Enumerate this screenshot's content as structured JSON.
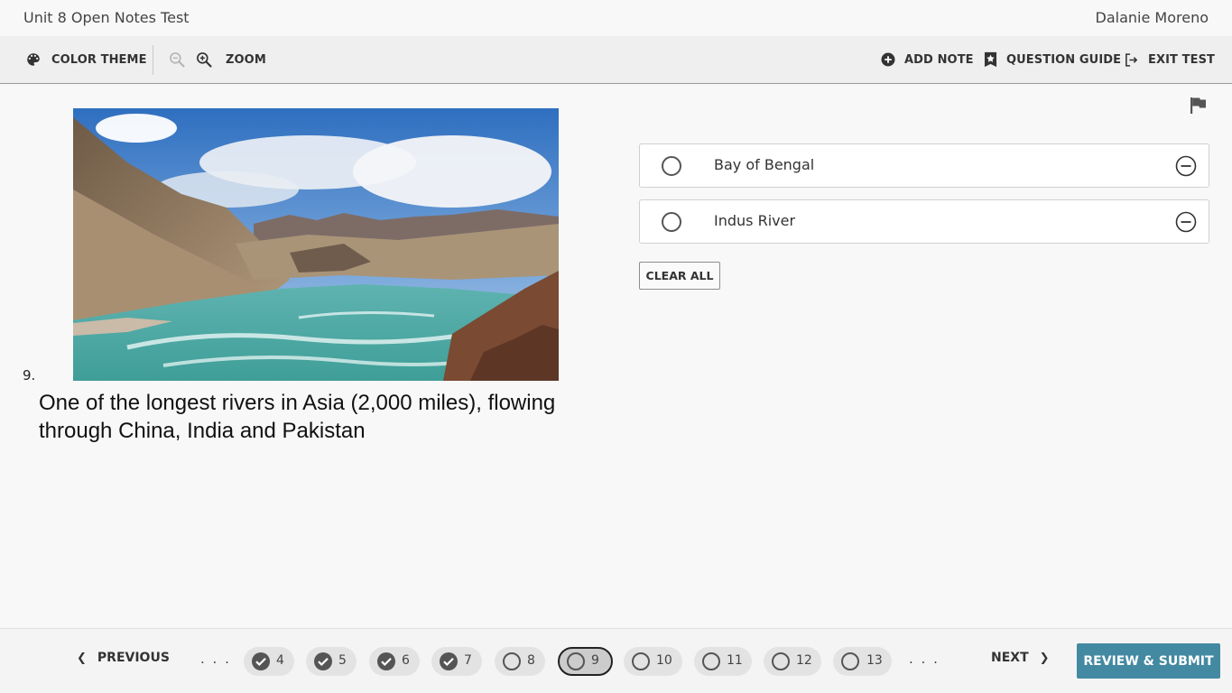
{
  "header": {
    "test_title": "Unit 8 Open Notes Test",
    "user_name": "Dalanie Moreno"
  },
  "toolbar": {
    "color_theme_label": "COLOR THEME",
    "zoom_label": "ZOOM",
    "add_note_label": "ADD NOTE",
    "question_guide_label": "QUESTION GUIDE",
    "exit_test_label": "EXIT TEST",
    "icons": [
      "palette-icon",
      "zoom-out-icon",
      "zoom-in-icon",
      "add-circle-icon",
      "bookmark-star-icon",
      "exit-icon"
    ]
  },
  "question": {
    "number": "9.",
    "text": "One of the longest rivers in Asia (2,000 miles), flowing through China, India and Pakistan",
    "image_subject": "mountain river valley photo",
    "flag_icon": "flag-icon"
  },
  "answers": {
    "options": [
      {
        "label": "Bay of Bengal",
        "selected": false
      },
      {
        "label": "Indus River",
        "selected": false
      }
    ],
    "clear_all_label": "CLEAR ALL"
  },
  "footer": {
    "previous_label": "PREVIOUS",
    "next_label": "NEXT",
    "ellipsis": ". . .",
    "review_submit_label": "REVIEW & SUBMIT",
    "current_question": "9",
    "pills": [
      {
        "num": "4",
        "status": "answered"
      },
      {
        "num": "5",
        "status": "answered"
      },
      {
        "num": "6",
        "status": "answered"
      },
      {
        "num": "7",
        "status": "answered"
      },
      {
        "num": "8",
        "status": "unanswered"
      },
      {
        "num": "9",
        "status": "current"
      },
      {
        "num": "10",
        "status": "unanswered"
      },
      {
        "num": "11",
        "status": "unanswered"
      },
      {
        "num": "12",
        "status": "unanswered"
      },
      {
        "num": "13",
        "status": "unanswered"
      }
    ]
  },
  "colors": {
    "accent": "#4389a2",
    "background": "#f8f8f8",
    "toolbar": "#efefef",
    "pill": "#e3e3e3"
  }
}
